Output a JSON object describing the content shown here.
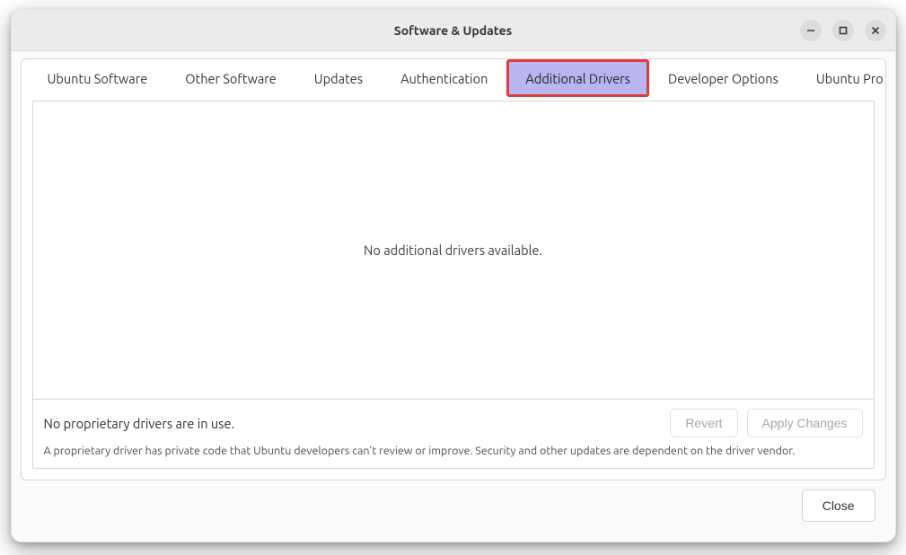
{
  "window": {
    "title": "Software & Updates"
  },
  "tabs": [
    {
      "label": "Ubuntu Software"
    },
    {
      "label": "Other Software"
    },
    {
      "label": "Updates"
    },
    {
      "label": "Authentication"
    },
    {
      "label": "Additional Drivers",
      "highlighted": true
    },
    {
      "label": "Developer Options"
    },
    {
      "label": "Ubuntu Pro"
    }
  ],
  "panel": {
    "empty_message": "No additional drivers available.",
    "status_text": "No proprietary drivers are in use.",
    "revert_label": "Revert",
    "apply_label": "Apply Changes",
    "hint": "A proprietary driver has private code that Ubuntu developers can't review or improve. Security and other updates are dependent on the driver vendor."
  },
  "footer": {
    "close_label": "Close"
  }
}
